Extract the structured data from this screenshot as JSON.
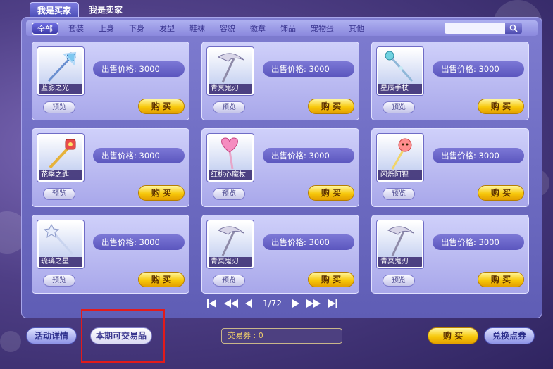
{
  "tabs": [
    "我是买家",
    "我是卖家"
  ],
  "categories": [
    "全部",
    "套装",
    "上身",
    "下身",
    "发型",
    "鞋袜",
    "容貌",
    "徽章",
    "饰品",
    "宠物蛋",
    "其他"
  ],
  "search": {
    "placeholder": ""
  },
  "items": [
    {
      "name": "蓝影之光",
      "price": "出售价格: 3000",
      "preview": "预览",
      "buy": "购 买"
    },
    {
      "name": "青冥鬼刃",
      "price": "出售价格: 3000",
      "preview": "预览",
      "buy": "购 买"
    },
    {
      "name": "星辰手杖",
      "price": "出售价格: 3000",
      "preview": "预览",
      "buy": "购 买"
    },
    {
      "name": "花季之匙",
      "price": "出售价格: 3000",
      "preview": "预览",
      "buy": "购 买"
    },
    {
      "name": "红桃心魔杖",
      "price": "出售价格: 3000",
      "preview": "预览",
      "buy": "购 买"
    },
    {
      "name": "闪烁阿狸",
      "price": "出售价格: 3000",
      "preview": "预览",
      "buy": "购 买"
    },
    {
      "name": "琉璃之星",
      "price": "出售价格: 3000",
      "preview": "预览",
      "buy": "购 买"
    },
    {
      "name": "青冥鬼刃",
      "price": "出售价格: 3000",
      "preview": "预览",
      "buy": "购 买"
    },
    {
      "name": "青冥鬼刃",
      "price": "出售价格: 3000",
      "preview": "预览",
      "buy": "购 买"
    }
  ],
  "pager": {
    "page": "1/72"
  },
  "footer": {
    "activity": "活动详情",
    "tradable": "本期可交易品",
    "voucher": "交易券 : 0",
    "buy": "购 买",
    "exchange": "兑换点券"
  },
  "colors": {
    "accent": "#5f5db5",
    "buy": "#f7c80a",
    "highlight": "#e21b1b"
  }
}
